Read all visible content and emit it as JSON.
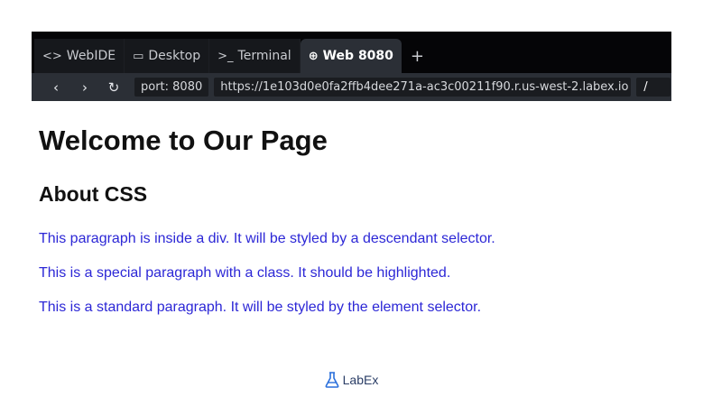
{
  "ide": {
    "tabs": [
      {
        "label": "WebIDE",
        "icon": "code-icon",
        "glyph": "<>"
      },
      {
        "label": "Desktop",
        "icon": "monitor-icon",
        "glyph": "▭"
      },
      {
        "label": "Terminal",
        "icon": "terminal-icon",
        "glyph": ">_"
      },
      {
        "label": "Web 8080",
        "icon": "globe-icon",
        "glyph": "⊕",
        "active": true
      }
    ],
    "add_tab_glyph": "+",
    "nav": {
      "back_glyph": "‹",
      "forward_glyph": "›",
      "reload_glyph": "↻",
      "port": "port: 8080",
      "url": "https://1e103d0e0fa2ffb4dee271a-ac3c00211f90.r.us-west-2.labex.io",
      "path": "/"
    }
  },
  "page": {
    "h1": "Welcome to Our Page",
    "h2": "About CSS",
    "paragraphs": [
      "This paragraph is inside a div. It will be styled by a descendant selector.",
      "This is a special paragraph with a class. It should be highlighted.",
      "This is a standard paragraph. It will be styled by the element selector."
    ],
    "paragraph_color": "#2c27d6"
  },
  "footer": {
    "brand": "LabEx",
    "icon": "flask-icon"
  }
}
